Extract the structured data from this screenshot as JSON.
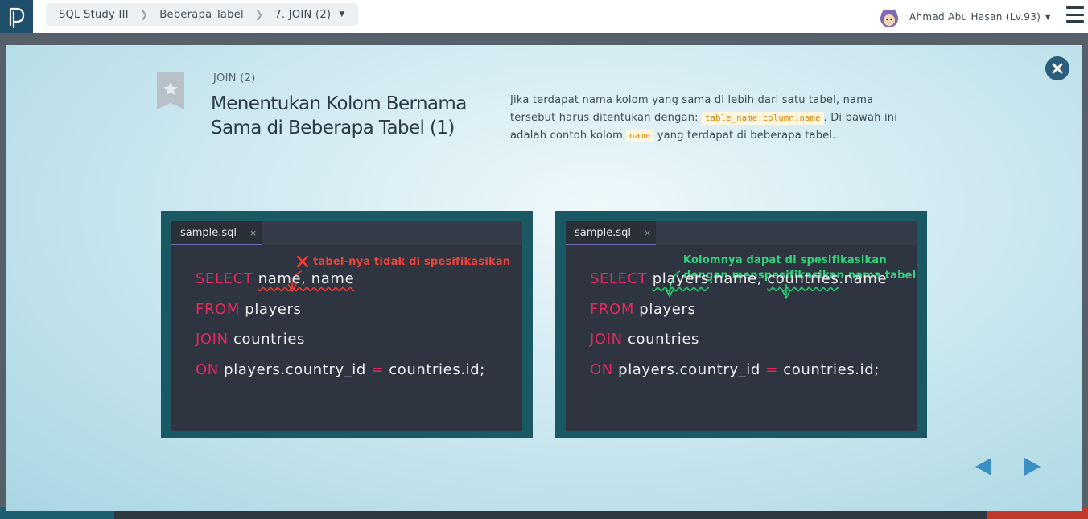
{
  "breadcrumb": {
    "course": "SQL Study III",
    "section": "Beberapa Tabel",
    "lesson": "7. JOIN (2)"
  },
  "user": {
    "name": "Ahmad Abu Hasan (Lv.93)"
  },
  "slide": {
    "kicker": "JOIN (2)",
    "title_line1": "Menentukan Kolom Bernama",
    "title_line2": "Sama di Beberapa Tabel (1)",
    "desc_part1": "Jika terdapat nama kolom yang sama di lebih dari satu tabel, nama tersebut harus ditentukan dengan: ",
    "desc_code1": "table_name.column.name",
    "desc_part2": ". Di bawah ini adalah contoh kolom ",
    "desc_code2": "name",
    "desc_part3": " yang terdapat di beberapa tabel."
  },
  "editor_left": {
    "tab_label": "sample.sql",
    "tab_close": "×",
    "note": "tabel-nya tidak di spesifikasikan",
    "kw_select": "SELECT",
    "sel_cols": "name, name",
    "kw_from": "FROM",
    "from_table": "players",
    "kw_join": "JOIN",
    "join_table": "countries",
    "kw_on": "ON",
    "on_left": "players.country_id",
    "on_op": "=",
    "on_right": "countries.id;"
  },
  "editor_right": {
    "tab_label": "sample.sql",
    "tab_close": "×",
    "note_line1": "Kolomnya dapat di spesifikasikan",
    "note_line2": "dengan menspesifikasikan nama tabel",
    "kw_select": "SELECT",
    "sel_t1": "players",
    "sel_c1": ".name, ",
    "sel_t2": "countries",
    "sel_c2": ".name",
    "kw_from": "FROM",
    "from_table": "players",
    "kw_join": "JOIN",
    "join_table": "countries",
    "kw_on": "ON",
    "on_left": "players.country_id",
    "on_op": "=",
    "on_right": "countries.id;"
  },
  "colors": {
    "keyword": "#e3295e",
    "error_note": "#f0413a",
    "ok_note": "#2fd67a",
    "modal_close": "#2a5d7c",
    "nav_arrow": "#3a8fc4"
  },
  "icons": {
    "logo": "progate-logo-icon",
    "close": "close-icon",
    "bookmark": "star-bookmark-icon",
    "prev": "triangle-left-icon",
    "next": "triangle-right-icon",
    "menu": "hamburger-menu-icon"
  }
}
